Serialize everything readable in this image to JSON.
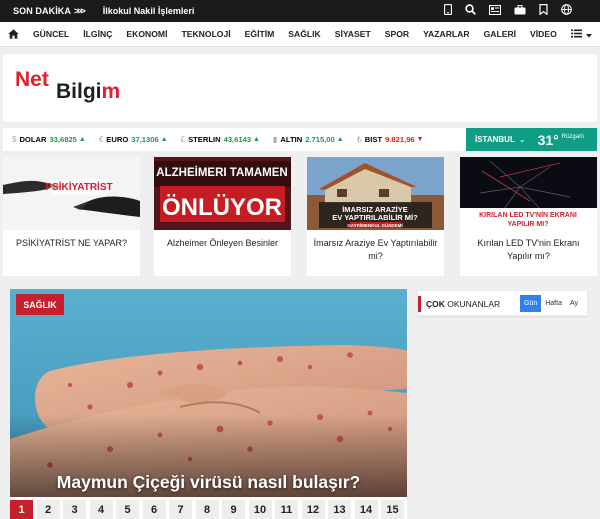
{
  "ticker": {
    "label": "SON DAKİKA",
    "arrows": ">>>",
    "headline": "İlkokul Nakil İşlemleri",
    "icons": [
      "mobile-icon",
      "search-icon",
      "news-icon",
      "briefcase-icon",
      "bookmark-icon",
      "globe-icon"
    ]
  },
  "nav": {
    "items": [
      "GÜNCEL",
      "İLGİNÇ",
      "EKONOMİ",
      "TEKNOLOJİ",
      "EĞİTİM",
      "SAĞLIK",
      "SİYASET",
      "SPOR",
      "YAZARLAR",
      "GALERİ",
      "VİDEO"
    ]
  },
  "logo": {
    "part1": "Net",
    "part2": "Bilgi",
    "part3": "m"
  },
  "currency": [
    {
      "sym": "$",
      "name": "DOLAR",
      "value": "33,6825",
      "trend": "up"
    },
    {
      "sym": "€",
      "name": "EURO",
      "value": "37,1306",
      "trend": "up"
    },
    {
      "sym": "£",
      "name": "STERLIN",
      "value": "43,6143",
      "trend": "up"
    },
    {
      "sym": "▮",
      "name": "ALTIN",
      "value": "2.715,00",
      "trend": "up"
    },
    {
      "sym": "₺",
      "name": "BIST",
      "value": "9.821,96",
      "trend": "down"
    }
  ],
  "weather": {
    "city": "İSTANBUL",
    "temp": "31°",
    "desc": "Rüzgarlı"
  },
  "cards": [
    {
      "caption": "PSİKİYATRİST NE YAPAR?",
      "image_text": "PSİKİYATRİST"
    },
    {
      "caption": "Alzheimer Önleyen Besinler",
      "image_text_1": "ALZHEİMERI TAMAMEN",
      "image_text_2": "ÖNLÜYOR"
    },
    {
      "caption": "İmarsız Araziye Ev Yaptırılabilir mi?",
      "image_text_1": "İMARSIZ ARAZİYE",
      "image_text_2": "EV YAPTIRILABİLİR Mİ?",
      "image_text_3": "GAYRİMENKUL GÜNDEMİ"
    },
    {
      "caption": "Kırılan LED TV'nin Ekranı Yapılır mı?",
      "image_text_1": "KIRILAN LED TV'NİN EKRANI",
      "image_text_2": "YAPILIR MI?"
    }
  ],
  "main": {
    "badge": "SAĞLIK",
    "title": "Maymun Çiçeği virüsü nasıl bulaşır?",
    "pages": [
      "1",
      "2",
      "3",
      "4",
      "5",
      "6",
      "7",
      "8",
      "9",
      "10",
      "11",
      "12",
      "13",
      "14",
      "15"
    ]
  },
  "sidebar": {
    "title_bold": "ÇOK",
    "title_rest": " OKUNANLAR",
    "tabs": [
      "Gün",
      "Hafta",
      "Ay"
    ]
  },
  "colors": {
    "accent_red": "#c6202f",
    "weather_green": "#0f9e83",
    "tab_blue": "#2f80ed",
    "up_green": "#1a9a52",
    "down_red": "#e02222"
  }
}
